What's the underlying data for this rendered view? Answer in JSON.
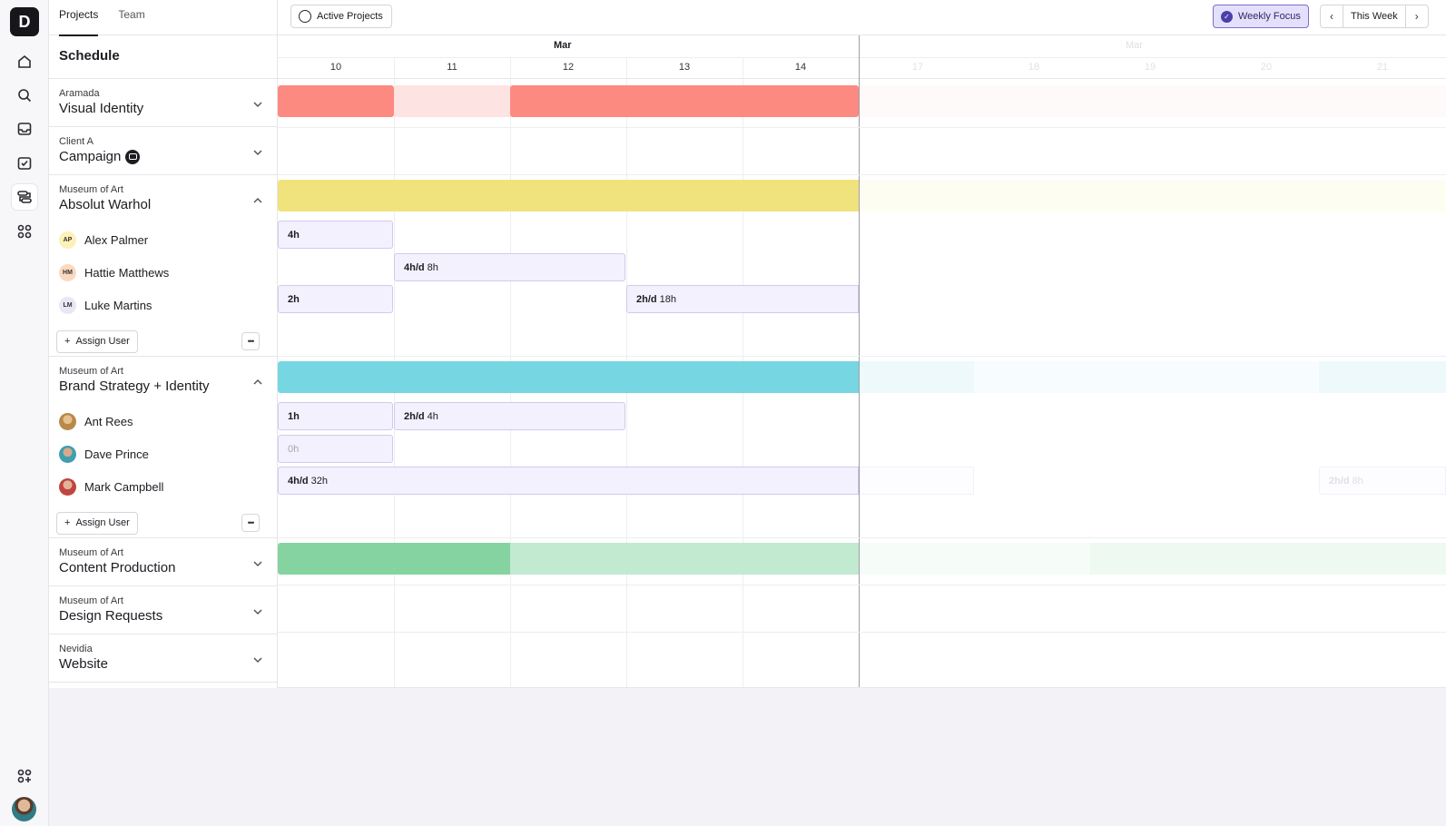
{
  "rail": {
    "logo": "D",
    "icons": [
      "home-icon",
      "search-icon",
      "inbox-icon",
      "tasks-icon",
      "schedule-icon",
      "apps-icon"
    ],
    "bottom_icons": [
      "add-apps-icon"
    ]
  },
  "panel": {
    "tabs": [
      {
        "label": "Projects",
        "active": true
      },
      {
        "label": "Team",
        "active": false
      }
    ],
    "title": "Schedule",
    "projects": [
      {
        "client": "Aramada",
        "name": "Visual Identity",
        "expanded": false
      },
      {
        "client": "Client A",
        "name": "Campaign",
        "expanded": false,
        "badge": true
      },
      {
        "client": "Museum of Art",
        "name": "Absolut Warhol",
        "expanded": true,
        "members": [
          {
            "initials": "AP",
            "name": "Alex Palmer",
            "color": "#fdf1b8"
          },
          {
            "initials": "HM",
            "name": "Hattie Matthews",
            "color": "#fbd9c0"
          },
          {
            "initials": "LM",
            "name": "Luke Martins",
            "color": "#e8e7f4"
          }
        ],
        "assign_label": "Assign User"
      },
      {
        "client": "Museum of Art",
        "name": "Brand Strategy + Identity",
        "expanded": true,
        "members": [
          {
            "initials": "",
            "name": "Ant Rees",
            "color": "#b88a4a"
          },
          {
            "initials": "",
            "name": "Dave Prince",
            "color": "#3f9fb0"
          },
          {
            "initials": "",
            "name": "Mark Campbell",
            "color": "#c0453f"
          }
        ],
        "assign_label": "Assign User"
      },
      {
        "client": "Museum of Art",
        "name": "Content Production",
        "expanded": false
      },
      {
        "client": "Museum of Art",
        "name": "Design Requests",
        "expanded": false
      },
      {
        "client": "Nevidia",
        "name": "Website",
        "expanded": false
      }
    ]
  },
  "toolbar": {
    "active_projects": "Active Projects",
    "weekly_focus": "Weekly Focus",
    "this_week": "This Week",
    "prev": "‹",
    "next": "›"
  },
  "timeline": {
    "month_current": "Mar",
    "month_next": "Mar",
    "days_current": [
      "10",
      "11",
      "12",
      "13",
      "14"
    ],
    "days_next": [
      "17",
      "18",
      "19",
      "20",
      "21"
    ],
    "allocations": {
      "alex_1": {
        "bold": "4h",
        "rest": ""
      },
      "hattie_1": {
        "bold": "4h/d",
        "rest": "8h"
      },
      "luke_1": {
        "bold": "2h",
        "rest": ""
      },
      "luke_2": {
        "bold": "2h/d",
        "rest": "18h"
      },
      "ant_1": {
        "bold": "1h",
        "rest": ""
      },
      "ant_2": {
        "bold": "2h/d",
        "rest": "4h"
      },
      "dave_1": {
        "bold": "",
        "rest": "0h"
      },
      "mark_1": {
        "bold": "4h/d",
        "rest": "32h"
      },
      "mark_ghost": {
        "bold": "2h/d",
        "rest": "8h"
      }
    },
    "colors": {
      "visual_identity": "#fd8a80",
      "visual_identity_light": "#fde3e1",
      "absolut_warhol": "#f0e37e",
      "brand_strategy": "#76d7e3",
      "content_production": "#86d3a2",
      "content_production_light": "#c2ead1"
    }
  }
}
